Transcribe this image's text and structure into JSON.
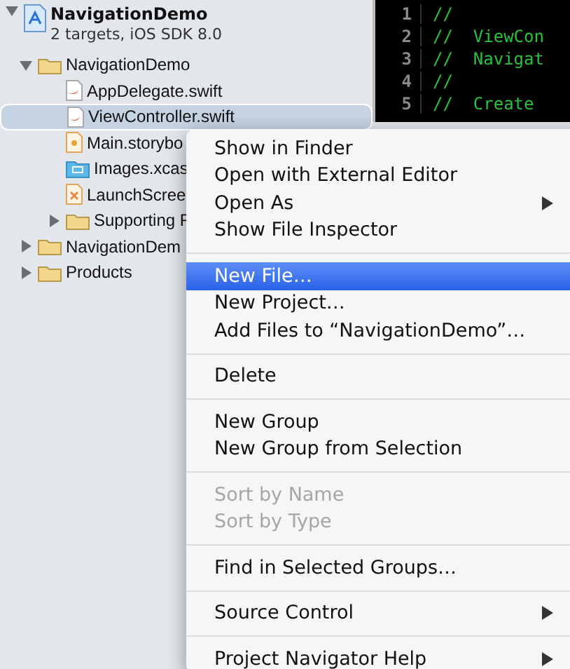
{
  "navigator": {
    "project": {
      "name": "NavigationDemo",
      "subtitle": "2 targets, iOS SDK 8.0",
      "expanded": true
    },
    "items": [
      {
        "kind": "folder",
        "label": "NavigationDemo",
        "expanded": true,
        "selected": false,
        "children": [
          {
            "kind": "swift",
            "label": "AppDelegate.swift",
            "selected": false
          },
          {
            "kind": "swift",
            "label": "ViewController.swift",
            "selected": true
          },
          {
            "kind": "storyboard",
            "label": "Main.storybo",
            "selected": false
          },
          {
            "kind": "assets",
            "label": "Images.xcas",
            "selected": false
          },
          {
            "kind": "xib",
            "label": "LaunchScree",
            "selected": false
          },
          {
            "kind": "folder",
            "label": "Supporting F",
            "expanded": false,
            "selected": false
          }
        ]
      },
      {
        "kind": "folder",
        "label": "NavigationDem",
        "expanded": false,
        "selected": false
      },
      {
        "kind": "folder",
        "label": "Products",
        "expanded": false,
        "selected": false
      }
    ]
  },
  "editor": {
    "lines": [
      {
        "number": "1",
        "code": "//"
      },
      {
        "number": "2",
        "code": "//  ViewCon"
      },
      {
        "number": "3",
        "code": "//  Navigat"
      },
      {
        "number": "4",
        "code": "//"
      },
      {
        "number": "5",
        "code": "//  Create"
      }
    ]
  },
  "context_menu": {
    "items": [
      {
        "kind": "item",
        "label": "Show in Finder",
        "selected": false,
        "disabled": false,
        "submenu": false
      },
      {
        "kind": "item",
        "label": "Open with External Editor",
        "selected": false,
        "disabled": false,
        "submenu": false
      },
      {
        "kind": "item",
        "label": "Open As",
        "selected": false,
        "disabled": false,
        "submenu": true
      },
      {
        "kind": "item",
        "label": "Show File Inspector",
        "selected": false,
        "disabled": false,
        "submenu": false
      },
      {
        "kind": "separator"
      },
      {
        "kind": "item",
        "label": "New File…",
        "selected": true,
        "disabled": false,
        "submenu": false
      },
      {
        "kind": "item",
        "label": "New Project…",
        "selected": false,
        "disabled": false,
        "submenu": false
      },
      {
        "kind": "item",
        "label": "Add Files to “NavigationDemo”…",
        "selected": false,
        "disabled": false,
        "submenu": false
      },
      {
        "kind": "separator"
      },
      {
        "kind": "item",
        "label": "Delete",
        "selected": false,
        "disabled": false,
        "submenu": false
      },
      {
        "kind": "separator"
      },
      {
        "kind": "item",
        "label": "New Group",
        "selected": false,
        "disabled": false,
        "submenu": false
      },
      {
        "kind": "item",
        "label": "New Group from Selection",
        "selected": false,
        "disabled": false,
        "submenu": false
      },
      {
        "kind": "separator"
      },
      {
        "kind": "item",
        "label": "Sort by Name",
        "selected": false,
        "disabled": true,
        "submenu": false
      },
      {
        "kind": "item",
        "label": "Sort by Type",
        "selected": false,
        "disabled": true,
        "submenu": false
      },
      {
        "kind": "separator"
      },
      {
        "kind": "item",
        "label": "Find in Selected Groups…",
        "selected": false,
        "disabled": false,
        "submenu": false
      },
      {
        "kind": "separator"
      },
      {
        "kind": "item",
        "label": "Source Control",
        "selected": false,
        "disabled": false,
        "submenu": true
      },
      {
        "kind": "separator"
      },
      {
        "kind": "item",
        "label": "Project Navigator Help",
        "selected": false,
        "disabled": false,
        "submenu": true
      }
    ]
  }
}
